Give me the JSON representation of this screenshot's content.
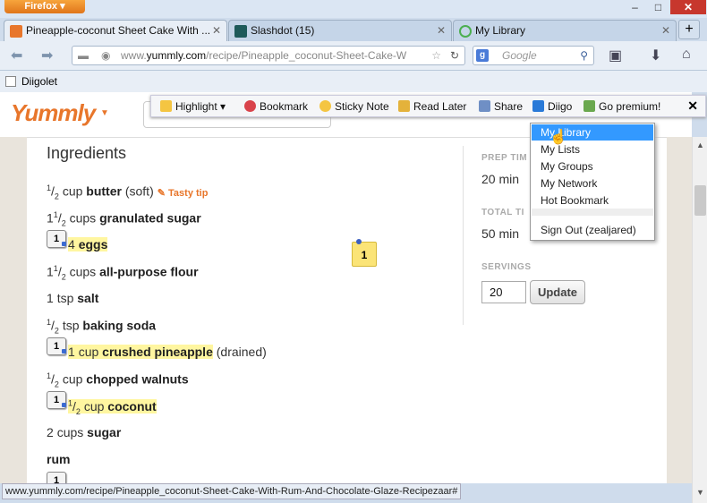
{
  "browser": {
    "menu_button": "Firefox",
    "window_controls": {
      "minimize": "–",
      "maximize": "□",
      "close": "✕"
    },
    "tabs": [
      {
        "title": "Pineapple-coconut Sheet Cake With ...",
        "favicon": "yummly-icon",
        "active": true
      },
      {
        "title": "Slashdot (15)",
        "favicon": "slashdot-icon",
        "active": false
      },
      {
        "title": "My Library",
        "favicon": "loading-icon",
        "active": false
      }
    ],
    "url_prefix": "www.",
    "url_domain": "yummly.com",
    "url_path": "/recipe/Pineapple_coconut-Sheet-Cake-W",
    "search_placeholder": "Google",
    "bookmarks_bar_label": "Diigolet",
    "status_url": "www.yummly.com/recipe/Pineapple_coconut-Sheet-Cake-With-Rum-And-Chocolate-Glaze-Recipezaar#"
  },
  "diigo_toolbar": {
    "highlight": "Highlight",
    "bookmark": "Bookmark",
    "sticky_note": "Sticky Note",
    "read_later": "Read Later",
    "share": "Share",
    "diigo": "Diigo",
    "go_premium": "Go premium!",
    "close": "✕"
  },
  "diigo_menu": {
    "items": [
      "My Library",
      "My Lists",
      "My Groups",
      "My Network",
      "Hot Bookmark"
    ],
    "sign_out": "Sign Out (zealjared)"
  },
  "page": {
    "logo": "Yummly",
    "ingredients_title": "Ingredients",
    "tasty_tip": "Tasty tip",
    "ingredients": [
      {
        "num": "1",
        "den": "2",
        "whole": "",
        "unit": "cup",
        "name": "butter",
        "note": "(soft)",
        "highlight": false
      },
      {
        "num": "1",
        "den": "2",
        "whole": "1",
        "unit": "cups",
        "name": "granulated sugar",
        "note": "",
        "highlight": false
      },
      {
        "num": "",
        "den": "",
        "whole": "4",
        "unit": "",
        "name": "eggs",
        "note": "",
        "highlight": true,
        "badge": "1"
      },
      {
        "num": "1",
        "den": "2",
        "whole": "1",
        "unit": "cups",
        "name": "all-purpose flour",
        "note": "",
        "highlight": false
      },
      {
        "num": "",
        "den": "",
        "whole": "1",
        "unit": "tsp",
        "name": "salt",
        "note": "",
        "highlight": false
      },
      {
        "num": "1",
        "den": "2",
        "whole": "",
        "unit": "tsp",
        "name": "baking soda",
        "note": "",
        "highlight": false
      },
      {
        "num": "",
        "den": "",
        "whole": "1",
        "unit": "cup",
        "name": "crushed pineapple",
        "note": "(drained)",
        "highlight": true,
        "badge": "1"
      },
      {
        "num": "1",
        "den": "2",
        "whole": "",
        "unit": "cup",
        "name": "chopped walnuts",
        "note": "",
        "highlight": false
      },
      {
        "num": "1",
        "den": "2",
        "whole": "",
        "unit": "cup",
        "name": "coconut",
        "note": "",
        "highlight": true,
        "badge": "1"
      },
      {
        "num": "",
        "den": "",
        "whole": "2",
        "unit": "cups",
        "name": "sugar",
        "note": "",
        "highlight": false
      },
      {
        "num": "",
        "den": "",
        "whole": "",
        "unit": "",
        "name": "rum",
        "note": "",
        "highlight": false
      }
    ],
    "sticky_count": "1",
    "prep_time_label": "PREP TIM",
    "prep_time_value": "20 min",
    "total_time_label": "TOTAL TI",
    "total_time_value": "50 min",
    "servings_label": "SERVINGS",
    "servings_value": "20",
    "update_button": "Update"
  }
}
